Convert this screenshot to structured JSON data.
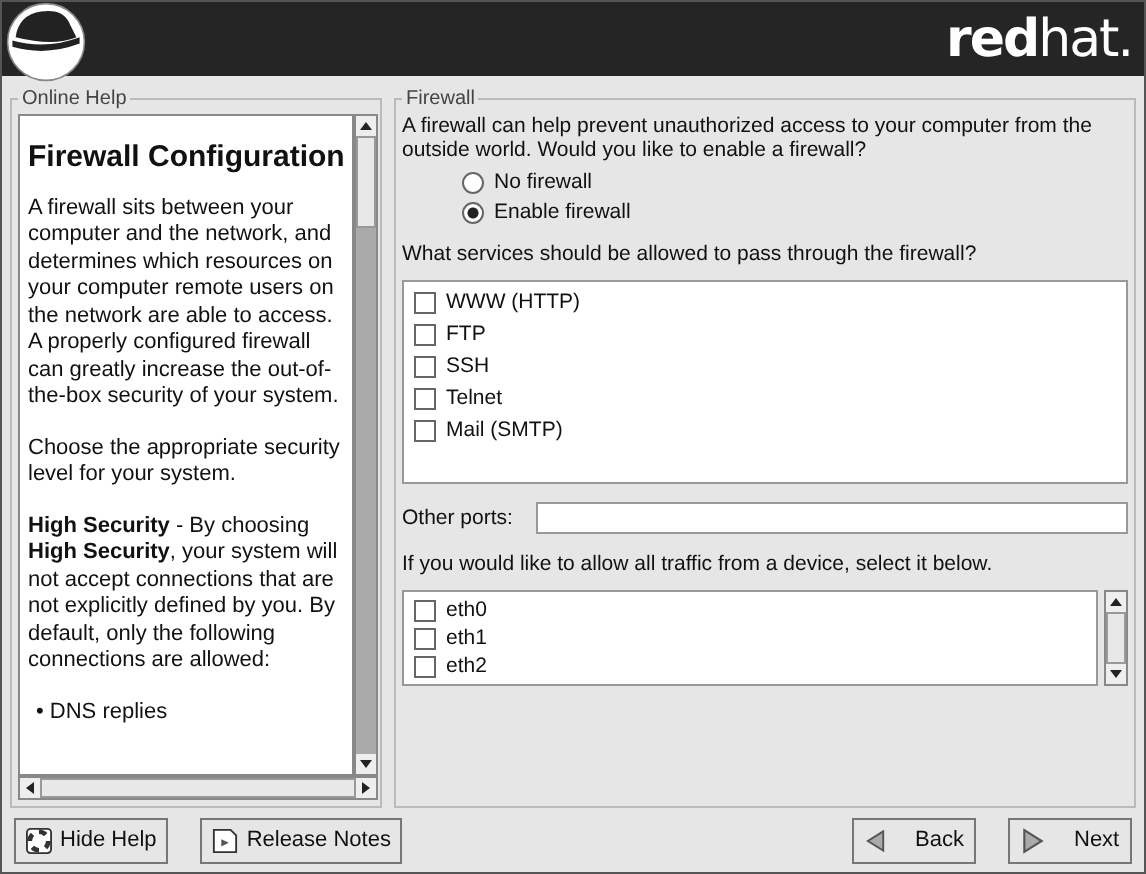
{
  "header": {
    "wordmark": "**red**hat."
  },
  "help": {
    "title": "Online Help",
    "heading": "Firewall Configuration",
    "paragraphs": [
      "A firewall sits between your computer and the network, and determines which resources on your computer remote users on the network are able to access. A properly configured firewall can greatly increase the out-of-the-box security of your system.",
      "Choose the appropriate security level for your system.",
      "**High Security** - By choosing **High Security**, your system will not accept connections that are not explicitly defined by you. By default, only the following connections are allowed:"
    ],
    "bullets": [
      "• DNS replies"
    ]
  },
  "firewall": {
    "title": "Firewall",
    "intro": "A firewall can help prevent unauthorized access to your computer from the outside world.  Would you like to enable a firewall?",
    "options": [
      {
        "label": "No firewall",
        "selected": false
      },
      {
        "label": "Enable firewall",
        "selected": true
      }
    ],
    "services_prompt": "What services should be allowed to pass through the firewall?",
    "services": [
      {
        "label": "WWW (HTTP)",
        "checked": false
      },
      {
        "label": "FTP",
        "checked": false
      },
      {
        "label": "SSH",
        "checked": false
      },
      {
        "label": "Telnet",
        "checked": false
      },
      {
        "label": "Mail (SMTP)",
        "checked": false
      }
    ],
    "other_ports": {
      "label": "Other ports:"
    },
    "devices_prompt": "If you would like to allow all traffic from a device, select it below.",
    "devices": [
      {
        "label": "eth0",
        "checked": false
      },
      {
        "label": "eth1",
        "checked": false
      },
      {
        "label": "eth2",
        "checked": false
      }
    ]
  },
  "buttons": {
    "left": [
      {
        "label": "Hide Help",
        "kind": "help"
      },
      {
        "label": "Release Notes",
        "kind": "notes"
      }
    ],
    "right": [
      {
        "label": "Back",
        "kind": "back"
      },
      {
        "label": "Next",
        "kind": "next"
      }
    ]
  }
}
